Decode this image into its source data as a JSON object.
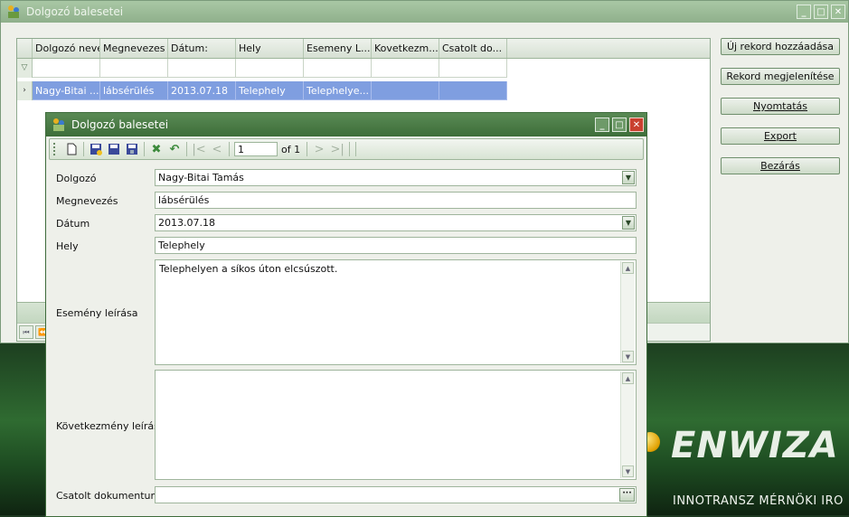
{
  "main_window": {
    "title": "Dolgozó balesetei",
    "grid": {
      "columns": [
        "Dolgozó neve",
        "Megnevezes",
        "Dátum:",
        "Hely",
        "Esemeny L...",
        "Kovetkezm...",
        "Csatolt do..."
      ],
      "rows": [
        [
          "Nagy-Bitai ...",
          "lábsérülés",
          "2013.07.18",
          "Telephely",
          "Telephelye...",
          "",
          ""
        ]
      ]
    },
    "buttons": {
      "new_record": "Új rekord hozzáadása",
      "show_record": "Rekord megjelenítése",
      "print": "Nyomtatás",
      "export": "Export",
      "close": "Bezárás"
    }
  },
  "detail_window": {
    "title": "Dolgozó balesetei",
    "toolbar": {
      "record_position": "1",
      "of_label": "of 1"
    },
    "fields": {
      "dolgozo": {
        "label": "Dolgozó",
        "value": "Nagy-Bitai Tamás"
      },
      "megnevezes": {
        "label": "Megnevezés",
        "value": "lábsérülés"
      },
      "datum": {
        "label": "Dátum",
        "value": "2013.07.18"
      },
      "hely": {
        "label": "Hely",
        "value": "Telephely"
      },
      "esemeny": {
        "label": "Esemény leírása",
        "value": "Telephelyen a síkos úton elcsúszott."
      },
      "kovetkezmeny": {
        "label": "Következmény leírása",
        "value": ""
      },
      "csatolt": {
        "label": "Csatolt dokumentum",
        "value": ""
      }
    }
  },
  "background": {
    "brand": "ENWIZA",
    "tagline": "INNOTRANSZ MÉRNÖKI IRO"
  },
  "colors": {
    "selected_row": "#7f9ee0",
    "detail_titlebar": "#4a7c45",
    "close_button": "#c9412f"
  }
}
